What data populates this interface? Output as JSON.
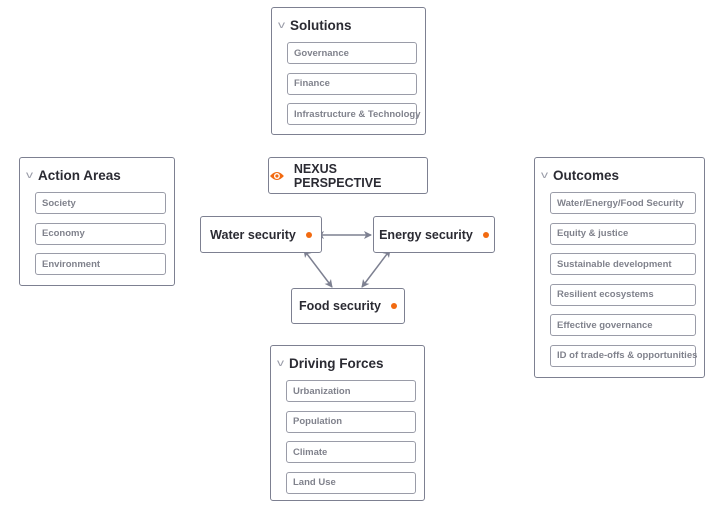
{
  "solutions": {
    "title": "Solutions",
    "items": [
      "Governance",
      "Finance",
      "Infrastructure & Technology"
    ]
  },
  "action_areas": {
    "title": "Action Areas",
    "items": [
      "Society",
      "Economy",
      "Environment"
    ]
  },
  "outcomes": {
    "title": "Outcomes",
    "items": [
      "Water/Energy/Food Security",
      "Equity & justice",
      "Sustainable development",
      "Resilient ecosystems",
      "Effective governance",
      "ID of trade-offs & opportunities"
    ]
  },
  "driving_forces": {
    "title": "Driving Forces",
    "items": [
      "Urbanization",
      "Population",
      "Climate",
      "Land Use"
    ]
  },
  "nexus": {
    "title": "NEXUS PERSPECTIVE",
    "icon": "eye-icon"
  },
  "nodes": {
    "water": "Water security",
    "energy": "Energy security",
    "food": "Food security"
  },
  "colors": {
    "accent": "#f26a10",
    "border": "#7d8091"
  }
}
